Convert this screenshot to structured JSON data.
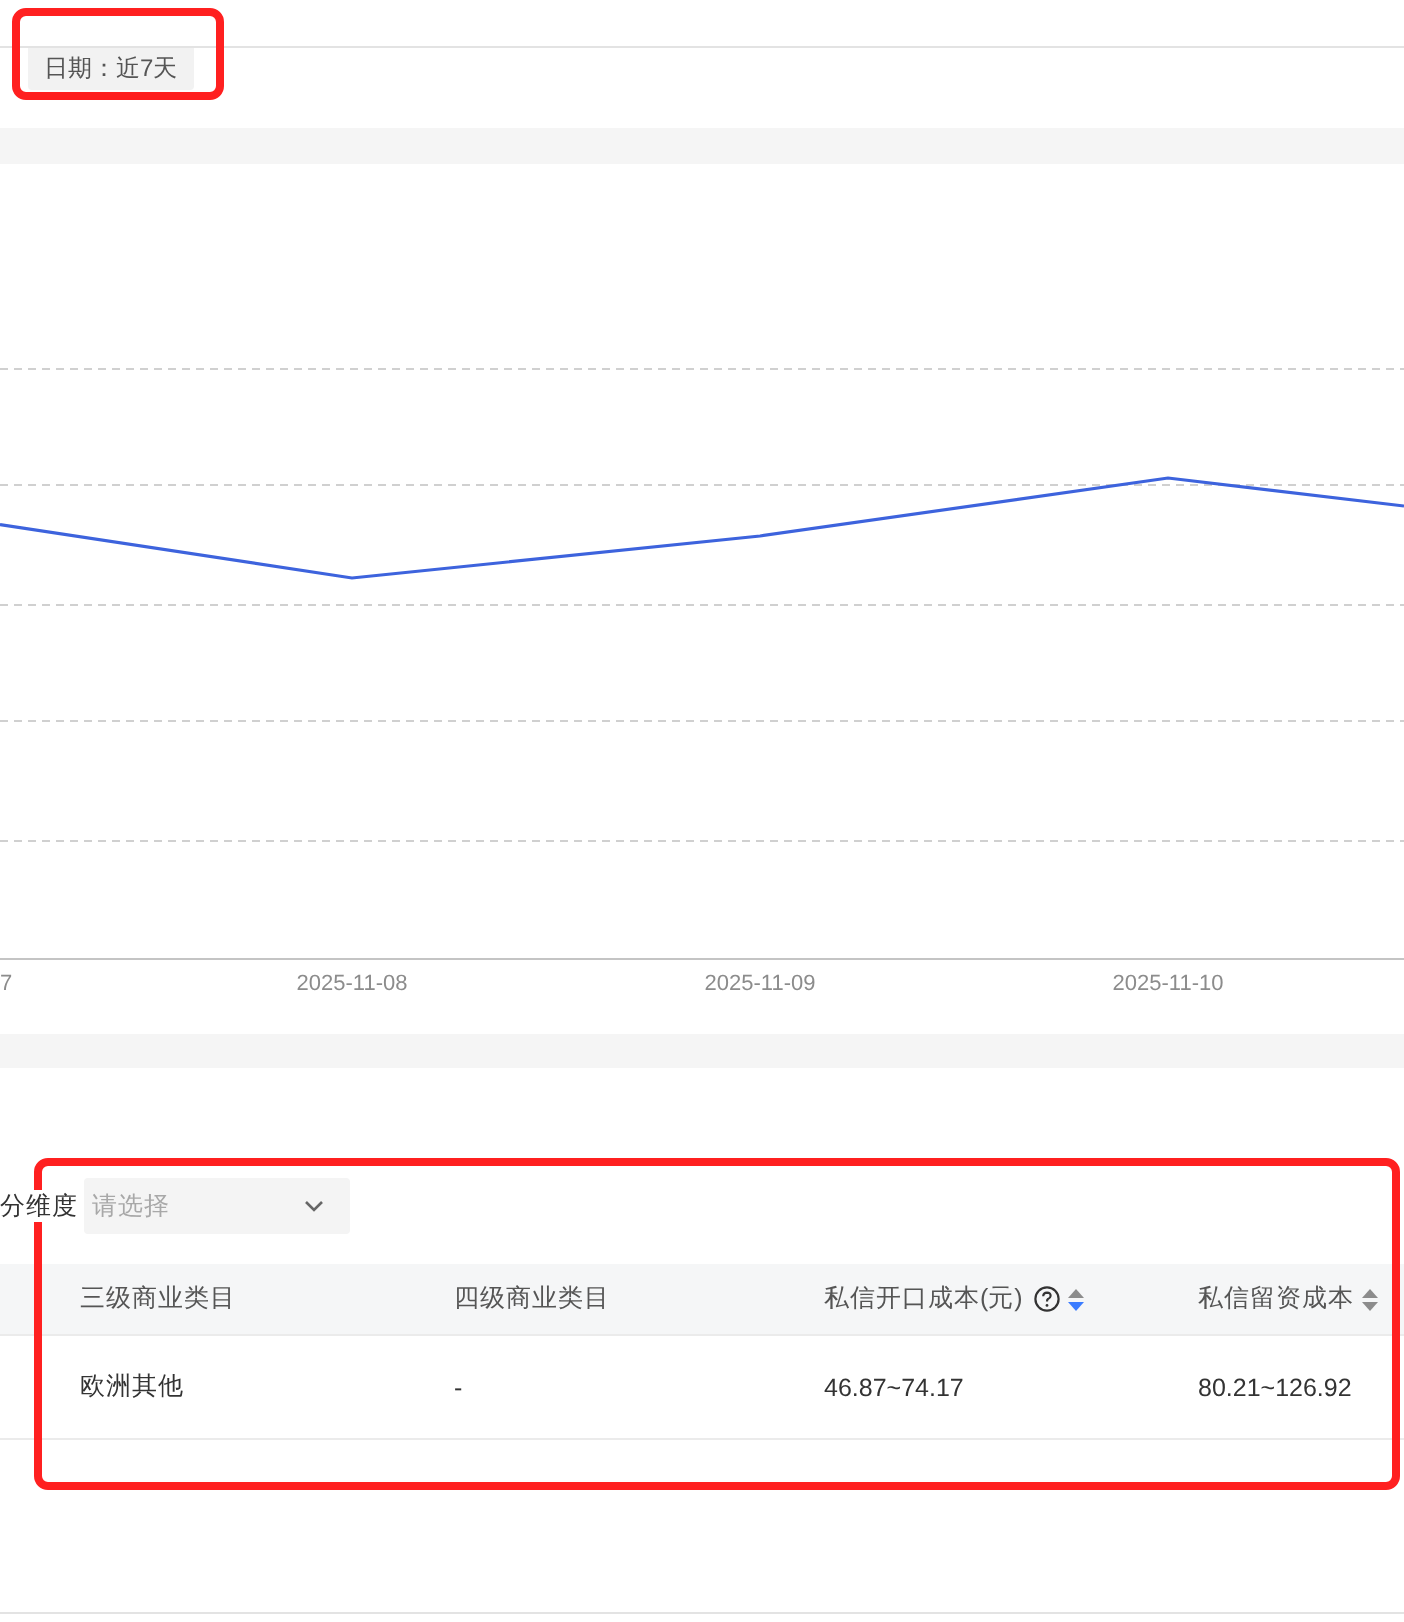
{
  "date_filter": {
    "label": "日期：近7天",
    "highlighted": true
  },
  "chart": {
    "x_labels": [
      "7",
      "2025-11-08",
      "2025-11-09",
      "2025-11-10"
    ]
  },
  "breakdown": {
    "highlighted": true,
    "dimension_filter": {
      "label": "分维度",
      "placeholder": "请选择"
    },
    "table": {
      "columns": [
        {
          "label": "三级商业类目"
        },
        {
          "label": "四级商业类目"
        },
        {
          "label": "私信开口成本(元)",
          "help": true,
          "sortable": true,
          "sorted_descending": true
        },
        {
          "label": "私信留资成本",
          "sortable": true,
          "sorted_descending": false
        }
      ],
      "rows": [
        {
          "cells": [
            "欧洲其他",
            "-",
            "46.87~74.17",
            "80.21~126.92"
          ]
        }
      ]
    }
  }
}
